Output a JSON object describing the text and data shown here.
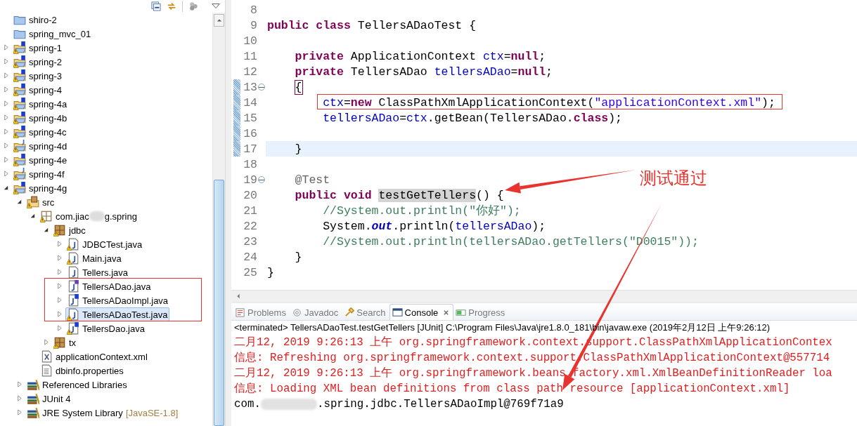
{
  "tree": [
    {
      "label": "shiro-2",
      "kind": "folder",
      "warning": false,
      "selected": false,
      "marked": false
    },
    {
      "label": "spring_mvc_01",
      "kind": "folder",
      "warning": false,
      "selected": false,
      "marked": false
    },
    {
      "label": "spring-1",
      "kind": "project-s",
      "warning": true,
      "expanded": false,
      "selected": false,
      "marked": false
    },
    {
      "label": "spring-2",
      "kind": "project-s",
      "warning": true,
      "expanded": false,
      "selected": false,
      "marked": false
    },
    {
      "label": "spring-3",
      "kind": "project-s",
      "warning": true,
      "expanded": false,
      "selected": false,
      "marked": false
    },
    {
      "label": "spring-4",
      "kind": "project-s",
      "warning": true,
      "expanded": false,
      "selected": false,
      "marked": false
    },
    {
      "label": "spring-4a",
      "kind": "project-s",
      "warning": true,
      "expanded": false,
      "selected": false,
      "marked": false
    },
    {
      "label": "spring-4b",
      "kind": "project-s",
      "warning": true,
      "expanded": false,
      "selected": false,
      "marked": false
    },
    {
      "label": "spring-4c",
      "kind": "project-s",
      "warning": true,
      "expanded": false,
      "selected": false,
      "marked": false
    },
    {
      "label": "spring-4d",
      "kind": "project-j",
      "warning": true,
      "expanded": false,
      "selected": false,
      "marked": false
    },
    {
      "label": "spring-4e",
      "kind": "project-s",
      "warning": true,
      "expanded": false,
      "selected": false,
      "marked": false
    },
    {
      "label": "spring-4f",
      "kind": "project-j",
      "warning": true,
      "expanded": false,
      "selected": false,
      "marked": false
    },
    {
      "label": "spring-4g",
      "kind": "project-s",
      "warning": true,
      "expanded": true,
      "selected": false,
      "marked": false,
      "children": [
        {
          "label": "src",
          "kind": "source-folder",
          "warning": true,
          "expanded": true,
          "selected": false,
          "marked": false,
          "children": [
            {
              "label": "com.jiac",
              "label_after_blur": "g.spring",
              "kind": "package-empty",
              "warning": true,
              "expanded": true,
              "selected": false,
              "marked": false,
              "children": [
                {
                  "label": "jdbc",
                  "kind": "package",
                  "warning": true,
                  "expanded": true,
                  "selected": false,
                  "marked": false,
                  "children": [
                    {
                      "label": "JDBCTest.java",
                      "kind": "java",
                      "warning": true,
                      "expanded": false,
                      "selected": false,
                      "marked": false
                    },
                    {
                      "label": "Main.java",
                      "kind": "java",
                      "warning": true,
                      "expanded": false,
                      "selected": false,
                      "marked": false
                    },
                    {
                      "label": "Tellers.java",
                      "kind": "java",
                      "warning": false,
                      "expanded": false,
                      "selected": false,
                      "marked": false
                    },
                    {
                      "label": "TellersADao.java",
                      "kind": "java-interface",
                      "warning": false,
                      "expanded": false,
                      "selected": false,
                      "marked": true
                    },
                    {
                      "label": "TellersADaoImpl.java",
                      "kind": "java-s",
                      "warning": false,
                      "expanded": false,
                      "selected": false,
                      "marked": true
                    },
                    {
                      "label": "TellersADaoTest.java",
                      "kind": "java",
                      "warning": true,
                      "expanded": false,
                      "selected": true,
                      "marked": true
                    },
                    {
                      "label": "TellersDao.java",
                      "kind": "java-s",
                      "warning": true,
                      "expanded": false,
                      "selected": false,
                      "marked": false
                    }
                  ]
                },
                {
                  "label": "tx",
                  "kind": "package",
                  "warning": true,
                  "expanded": false,
                  "selected": false,
                  "marked": false
                }
              ]
            },
            {
              "label": "applicationContext.xml",
              "kind": "xml",
              "warning": false,
              "selected": false,
              "marked": false
            },
            {
              "label": "dbinfo.properties",
              "kind": "properties",
              "warning": false,
              "selected": false,
              "marked": false
            }
          ]
        },
        {
          "label": "Referenced Libraries",
          "kind": "library",
          "warning": false,
          "expanded": false,
          "selected": false,
          "marked": false
        },
        {
          "label": "JUnit 4",
          "kind": "library",
          "warning": false,
          "expanded": false,
          "selected": false,
          "marked": false
        },
        {
          "label": "JRE System Library",
          "decoration": "[JavaSE-1.8]",
          "kind": "library",
          "warning": false,
          "expanded": false,
          "selected": false,
          "marked": false
        }
      ]
    }
  ],
  "editor": {
    "lines": [
      {
        "number": "8",
        "changed": false,
        "fold": false,
        "current": false,
        "marked": false
      },
      {
        "number": "9",
        "changed": false,
        "fold": false,
        "current": false,
        "marked": false,
        "segments": [
          {
            "kind": "keyword",
            "text": "public class"
          },
          {
            "kind": "plain",
            "text": " TellersADaoTest {"
          }
        ]
      },
      {
        "number": "10",
        "changed": false,
        "fold": false,
        "current": false,
        "marked": false
      },
      {
        "number": "11",
        "changed": false,
        "fold": false,
        "current": false,
        "marked": false,
        "segments": [
          {
            "kind": "keyword",
            "text": "    private"
          },
          {
            "kind": "plain",
            "text": " ApplicationContext "
          },
          {
            "kind": "field",
            "text": "ctx"
          },
          {
            "kind": "plain",
            "text": "="
          },
          {
            "kind": "keyword",
            "text": "null"
          },
          {
            "kind": "plain",
            "text": ";"
          }
        ]
      },
      {
        "number": "12",
        "changed": false,
        "fold": false,
        "current": false,
        "marked": false,
        "segments": [
          {
            "kind": "keyword",
            "text": "    private"
          },
          {
            "kind": "plain",
            "text": " TellersADao "
          },
          {
            "kind": "field",
            "text": "tellersADao"
          },
          {
            "kind": "plain",
            "text": "="
          },
          {
            "kind": "keyword",
            "text": "null"
          },
          {
            "kind": "plain",
            "text": ";"
          }
        ]
      },
      {
        "number": "13",
        "changed": true,
        "fold": true,
        "current": false,
        "marked": false,
        "segments": [
          {
            "kind": "bracket",
            "text": "    {"
          }
        ]
      },
      {
        "number": "14",
        "changed": true,
        "fold": false,
        "current": false,
        "marked": true,
        "segments": [
          {
            "kind": "field",
            "text": "        ctx"
          },
          {
            "kind": "plain",
            "text": "="
          },
          {
            "kind": "keyword",
            "text": "new"
          },
          {
            "kind": "plain",
            "text": " ClassPathXmlApplicationContext("
          },
          {
            "kind": "string",
            "text": "\"applicationContext.xml\""
          },
          {
            "kind": "plain",
            "text": ");"
          }
        ]
      },
      {
        "number": "15",
        "changed": true,
        "fold": false,
        "current": false,
        "marked": false,
        "segments": [
          {
            "kind": "field",
            "text": "        tellersADao"
          },
          {
            "kind": "plain",
            "text": "="
          },
          {
            "kind": "field",
            "text": "ctx"
          },
          {
            "kind": "plain",
            "text": ".getBean(TellersADao."
          },
          {
            "kind": "keyword",
            "text": "class"
          },
          {
            "kind": "plain",
            "text": ");"
          }
        ]
      },
      {
        "number": "16",
        "changed": true,
        "fold": false,
        "current": false,
        "marked": false
      },
      {
        "number": "17",
        "changed": true,
        "fold": false,
        "current": true,
        "marked": false,
        "segments": [
          {
            "kind": "plain",
            "text": "    }"
          }
        ]
      },
      {
        "number": "18",
        "changed": false,
        "fold": false,
        "current": false,
        "marked": false
      },
      {
        "number": "19",
        "changed": false,
        "fold": true,
        "current": false,
        "marked": false,
        "segments": [
          {
            "kind": "annotation",
            "text": "    @Test"
          }
        ]
      },
      {
        "number": "20",
        "changed": false,
        "fold": false,
        "current": false,
        "marked": false,
        "segments": [
          {
            "kind": "keyword",
            "text": "    public void "
          },
          {
            "kind": "occurrence",
            "text": "testGetTellers"
          },
          {
            "kind": "plain",
            "text": "() {"
          }
        ]
      },
      {
        "number": "21",
        "changed": false,
        "fold": false,
        "current": false,
        "marked": false,
        "segments": [
          {
            "kind": "comment",
            "text": "        //System.out.println(\"你好\");"
          }
        ]
      },
      {
        "number": "22",
        "changed": false,
        "fold": false,
        "current": false,
        "marked": false,
        "segments": [
          {
            "kind": "plain",
            "text": "        System."
          },
          {
            "kind": "static",
            "text": "out"
          },
          {
            "kind": "plain",
            "text": ".println("
          },
          {
            "kind": "field",
            "text": "tellersADao"
          },
          {
            "kind": "plain",
            "text": ");"
          }
        ]
      },
      {
        "number": "23",
        "changed": false,
        "fold": false,
        "current": false,
        "marked": false,
        "segments": [
          {
            "kind": "comment",
            "text": "        //System.out.println(tellersADao.getTellers(\"D0015\"));"
          }
        ]
      },
      {
        "number": "24",
        "changed": false,
        "fold": false,
        "current": false,
        "marked": false,
        "segments": [
          {
            "kind": "plain",
            "text": "    }"
          }
        ]
      },
      {
        "number": "25",
        "changed": false,
        "fold": false,
        "current": false,
        "marked": false,
        "segments": [
          {
            "kind": "plain",
            "text": "}"
          }
        ]
      }
    ]
  },
  "callout": {
    "text": "测试通过"
  },
  "console": {
    "tabs": [
      {
        "label": "Problems",
        "kind": "problems",
        "selected": false
      },
      {
        "label": "Javadoc",
        "kind": "javadoc",
        "selected": false
      },
      {
        "label": "Search",
        "kind": "search",
        "selected": false
      },
      {
        "label": "Console",
        "kind": "console",
        "selected": true
      },
      {
        "label": "Progress",
        "kind": "progress",
        "selected": false
      }
    ],
    "status": "<terminated> TellersADaoTest.testGetTellers [JUnit] C:\\Program Files\\Java\\jre1.8.0_181\\bin\\javaw.exe (2019年2月12日 上午9:26:12)",
    "output": [
      {
        "kind": "stderr",
        "text": "二月12, 2019 9:26:13 上午 org.springframework.context.support.ClassPathXmlApplicationContex"
      },
      {
        "kind": "stderr",
        "text": "信息: Refreshing org.springframework.context.support.ClassPathXmlApplicationContext@557714"
      },
      {
        "kind": "stderr",
        "text": "二月12, 2019 9:26:13 上午 org.springframework.beans.factory.xml.XmlBeanDefinitionReader loa"
      },
      {
        "kind": "stderr",
        "text": "信息: Loading XML bean definitions from class path resource [applicationContext.xml]"
      },
      {
        "kind": "stdout",
        "text": "com.",
        "text_after_blur": ".spring.jdbc.TellersADaoImpl@769f71a9"
      }
    ]
  }
}
